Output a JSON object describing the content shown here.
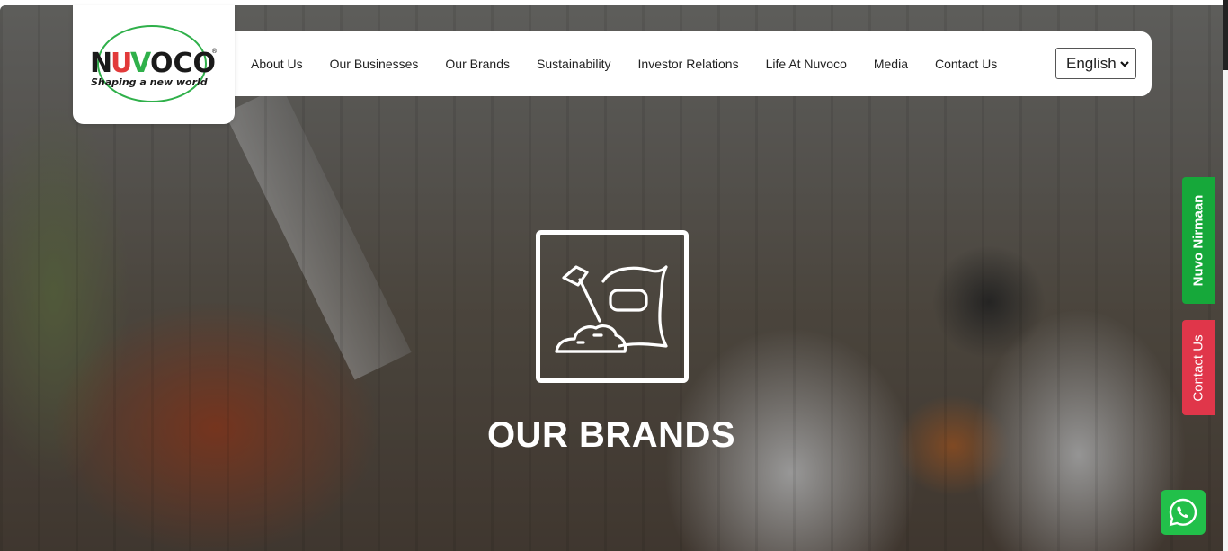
{
  "logo": {
    "brand": "NUVOCO",
    "tagline": "Shaping a new world",
    "registered": "®"
  },
  "nav": {
    "items": [
      {
        "label": "About Us"
      },
      {
        "label": "Our Businesses"
      },
      {
        "label": "Our Brands"
      },
      {
        "label": "Sustainability"
      },
      {
        "label": "Investor Relations"
      },
      {
        "label": "Life At Nuvoco"
      },
      {
        "label": "Media"
      },
      {
        "label": "Contact Us"
      }
    ]
  },
  "language": {
    "selected": "English"
  },
  "hero": {
    "title": "OUR BRANDS",
    "icon": "cement-bag-shovel-icon"
  },
  "side_tabs": {
    "nirmaan": "Nuvo Nirmaan",
    "contact": "Contact Us"
  },
  "colors": {
    "brand_green": "#16a83a",
    "brand_red": "#e0364a",
    "whatsapp": "#22c04a"
  }
}
